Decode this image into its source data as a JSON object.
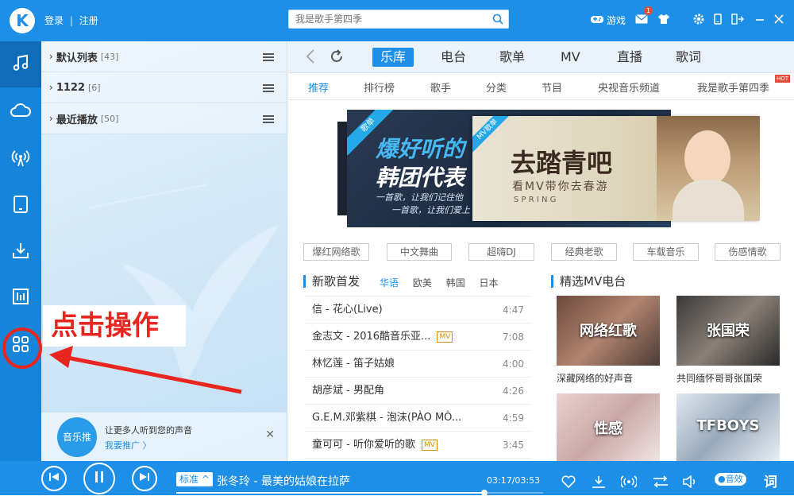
{
  "app": {
    "logo_letter": "K",
    "login": "登录",
    "sep": "|",
    "register": "注册"
  },
  "search": {
    "placeholder": "我是歌手第四季"
  },
  "top_right": {
    "game_label": "游戏",
    "msg_count": "1"
  },
  "playlists": [
    {
      "name": "默认列表",
      "count": "[43]"
    },
    {
      "name": "1122",
      "count": "[6]"
    },
    {
      "name": "最近播放",
      "count": "[50]"
    }
  ],
  "promo": {
    "circle_text": "音乐推",
    "line1": "让更多人听到您的声音",
    "line2": "我要推广 〉"
  },
  "nav": {
    "tabs": [
      "乐库",
      "电台",
      "歌单",
      "MV",
      "直播",
      "歌词"
    ],
    "active": "乐库"
  },
  "subnav": {
    "items": [
      "推荐",
      "排行榜",
      "歌手",
      "分类",
      "节目",
      "央视音乐频道",
      "我是歌手第四季"
    ],
    "hot": "HOT"
  },
  "banner": {
    "left_tag": "歌单",
    "left_line1": "爆好听的",
    "left_line2": "韩团代表",
    "left_sub1": "一首歌，让我们记住他",
    "left_sub2": "一首歌，让我们爱上",
    "right_tag": "MV歌单",
    "right_title": "去踏青吧",
    "right_sub": "看MV带你去春游",
    "right_en": "S P R I N G"
  },
  "genre_tags": [
    "爆红网络歌",
    "中文舞曲",
    "超嗨DJ",
    "经典老歌",
    "车载音乐",
    "伤感情歌"
  ],
  "new_songs": {
    "title": "新歌首发",
    "langs": [
      "华语",
      "欧美",
      "韩国",
      "日本"
    ],
    "active_lang": "华语",
    "mv_label": "MV",
    "list": [
      {
        "name": "信 - 花心(Live)",
        "time": "4:47",
        "mv": false
      },
      {
        "name": "金志文 - 2016酷音乐亚...",
        "time": "7:08",
        "mv": true
      },
      {
        "name": "林忆莲 - 笛子姑娘",
        "time": "4:00",
        "mv": false
      },
      {
        "name": "胡彦斌 - 男配角",
        "time": "4:26",
        "mv": false
      },
      {
        "name": "G.E.M.邓紫棋 - 泡沫(PÀO MÒ...",
        "time": "4:59",
        "mv": false
      },
      {
        "name": "童可可 - 听你爱听的歌",
        "time": "3:45",
        "mv": true
      }
    ]
  },
  "mv_radio": {
    "title": "精选MV电台",
    "cards": [
      {
        "label": "网络红歌",
        "caption": "深藏网络的好声音"
      },
      {
        "label": "张国荣",
        "caption": "共同缅怀哥哥张国荣"
      },
      {
        "label": "性感",
        "caption": ""
      },
      {
        "label": "TFBOYS",
        "caption": ""
      }
    ]
  },
  "player": {
    "quality": "标准 ^",
    "now_playing": "张冬玲 - 最美的姑娘在拉萨",
    "time": "03:17/03:53",
    "progress": 0.84,
    "effect": "●音效",
    "lyrics": "词"
  },
  "annotation": {
    "text": "点击操作"
  },
  "colors": {
    "brand": "#1e8fe6",
    "annotation_red": "#e8261f"
  }
}
